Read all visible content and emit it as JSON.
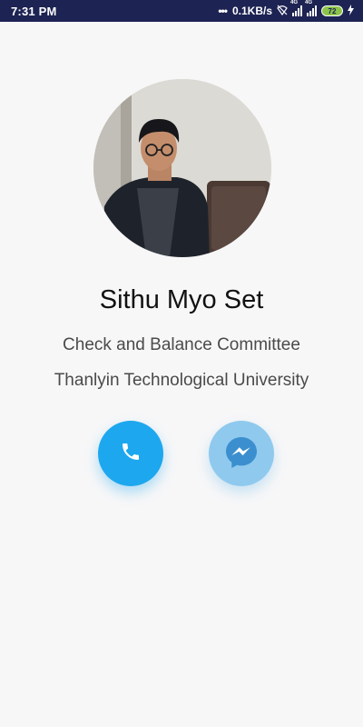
{
  "status_bar": {
    "time": "7:31 PM",
    "network_speed": "0.1KB/s",
    "network_type_1": "4G",
    "network_type_2": "4G",
    "battery_level": "72"
  },
  "profile": {
    "name": "Sithu Myo Set",
    "role": "Check and Balance Committee",
    "organization": "Thanlyin Technological University"
  },
  "actions": {
    "call_icon": "phone-icon",
    "messenger_icon": "messenger-icon"
  },
  "colors": {
    "status_bar": "#1d2352",
    "call_button": "#1da7ee",
    "messenger_button": "#8fc9ee",
    "background": "#f7f7f8"
  }
}
